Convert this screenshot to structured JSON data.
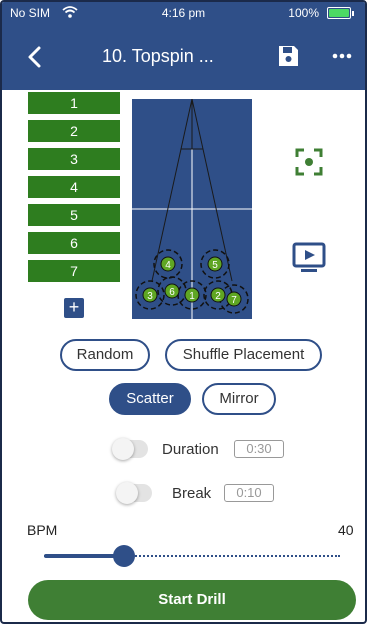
{
  "status_bar": {
    "carrier": "No SIM",
    "time": "4:16 pm",
    "battery": "100%",
    "wifi_icon": "wifi-icon",
    "battery_icon": "battery-charging-icon"
  },
  "nav": {
    "title": "10. Topspin ...",
    "back_icon": "chevron-left-icon",
    "save_icon": "save-icon",
    "more_icon": "more-horizontal-icon"
  },
  "placements": [
    "1",
    "2",
    "3",
    "4",
    "5",
    "6",
    "7"
  ],
  "add_icon": "plus-icon",
  "table_markers": [
    "4",
    "5",
    "3",
    "6",
    "1",
    "2",
    "7"
  ],
  "side_icons": {
    "focus": "focus-frame-icon",
    "preview": "play-preview-icon"
  },
  "options": {
    "random": "Random",
    "shuffle": "Shuffle Placement",
    "scatter": "Scatter",
    "mirror": "Mirror",
    "active": "Scatter"
  },
  "duration": {
    "label": "Duration",
    "value": "0:30",
    "enabled": false
  },
  "break": {
    "label": "Break",
    "value": "0:10",
    "enabled": false
  },
  "bpm": {
    "label": "BPM",
    "value": "40",
    "level": 0.27
  },
  "start_label": "Start Drill",
  "colors": {
    "brand_blue": "#2f4f88",
    "green": "#3f7f34",
    "placement_green": "#2e7d1f",
    "marker_green": "#5fa623"
  }
}
